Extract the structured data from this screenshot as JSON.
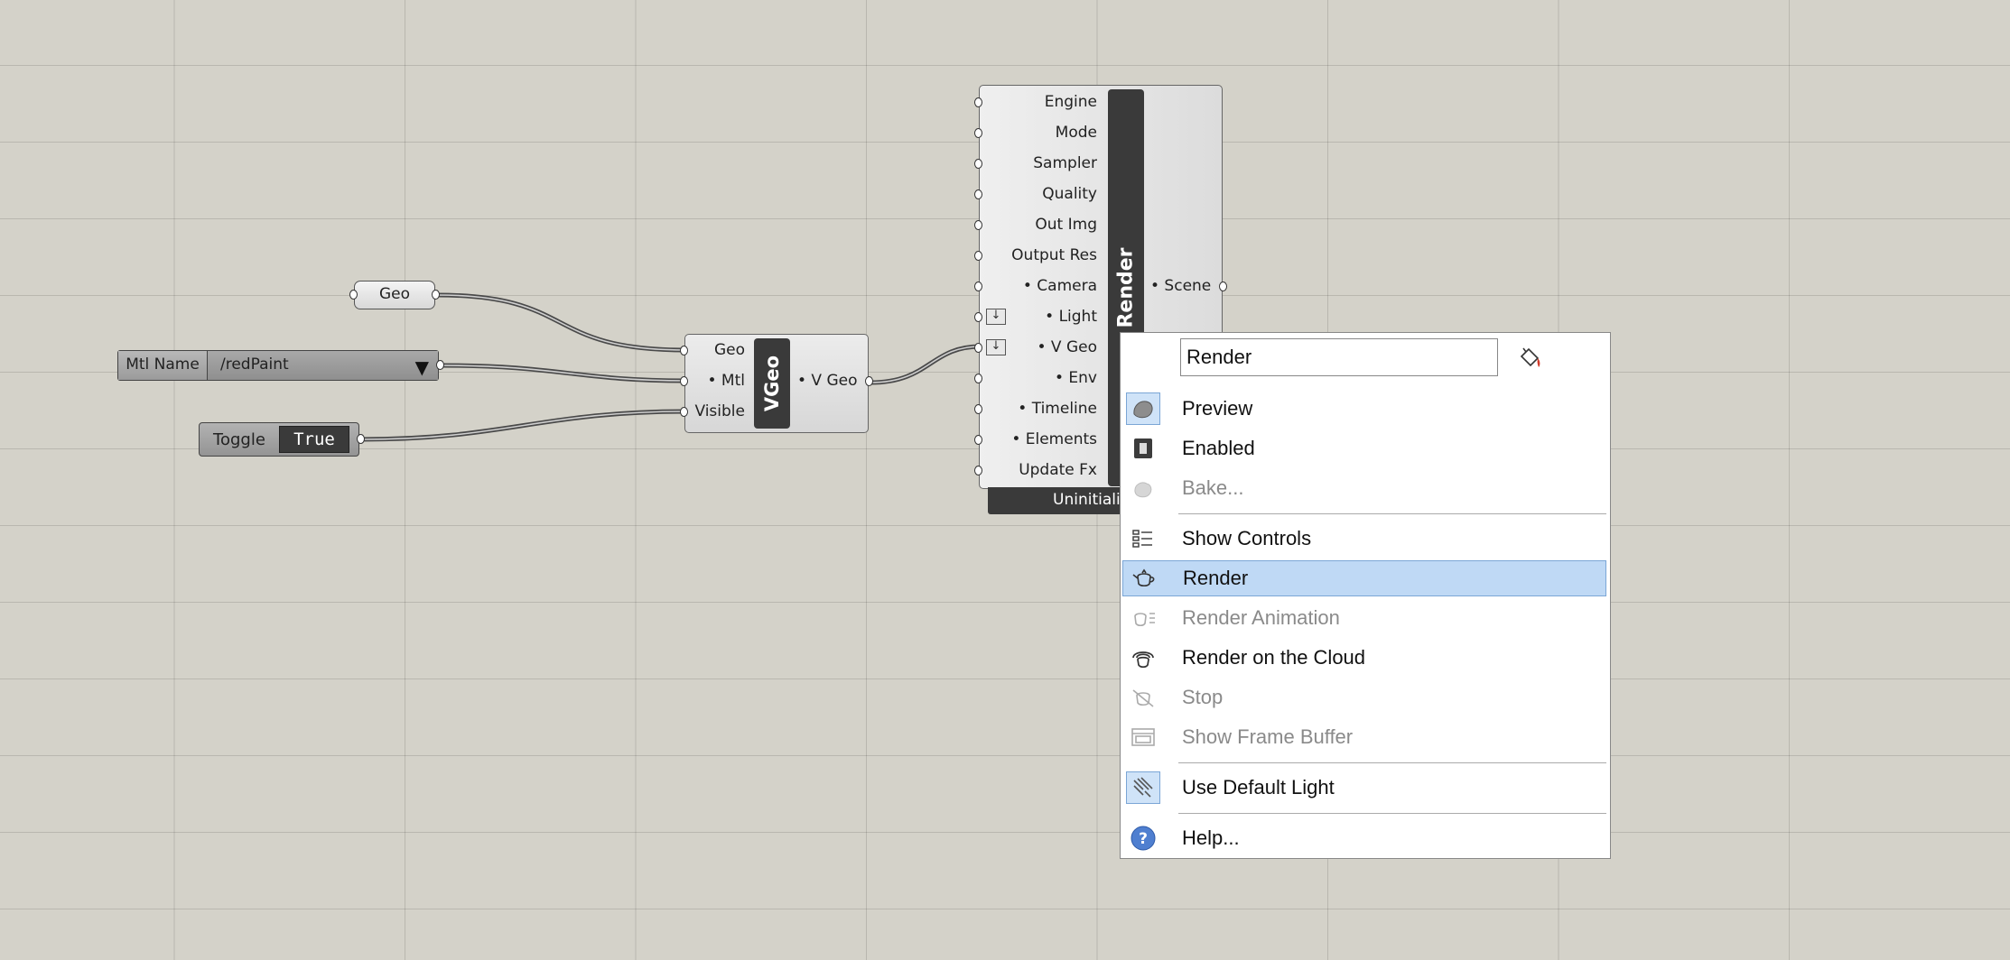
{
  "canvas": {
    "geo_param": {
      "label": "Geo"
    },
    "mtl_name": {
      "label": "Mtl Name",
      "value": "/redPaint"
    },
    "toggle": {
      "label": "Toggle",
      "value": "True"
    },
    "vgeo": {
      "title": "VGeo",
      "inputs": [
        "Geo",
        "• Mtl",
        "Visible"
      ],
      "output": "• V Geo"
    },
    "render": {
      "title": "Render",
      "inputs": [
        "Engine",
        "Mode",
        "Sampler",
        "Quality",
        "Out Img",
        "Output Res",
        "• Camera",
        "• Light",
        "• V Geo",
        "• Env",
        "• Timeline",
        "• Elements",
        "Update Fx"
      ],
      "output": "• Scene",
      "status": "Uninitialized"
    }
  },
  "menu": {
    "name_value": "Render",
    "items": [
      {
        "label": "Preview",
        "icon": "preview-icon",
        "enabled": true
      },
      {
        "label": "Enabled",
        "icon": "enabled-icon",
        "enabled": true
      },
      {
        "label": "Bake...",
        "icon": "bake-icon",
        "enabled": false
      },
      {
        "label": "Show Controls",
        "icon": "controls-icon",
        "enabled": true
      },
      {
        "label": "Render",
        "icon": "teapot-icon",
        "enabled": true,
        "highlighted": true
      },
      {
        "label": "Render Animation",
        "icon": "teapot-animation-icon",
        "enabled": false
      },
      {
        "label": "Render on the Cloud",
        "icon": "cloud-render-icon",
        "enabled": true
      },
      {
        "label": "Stop",
        "icon": "stop-icon",
        "enabled": false
      },
      {
        "label": "Show Frame Buffer",
        "icon": "frame-buffer-icon",
        "enabled": false
      },
      {
        "label": "Use Default Light",
        "icon": "default-light-icon",
        "enabled": true
      },
      {
        "label": "Help...",
        "icon": "help-icon",
        "enabled": true
      }
    ]
  }
}
